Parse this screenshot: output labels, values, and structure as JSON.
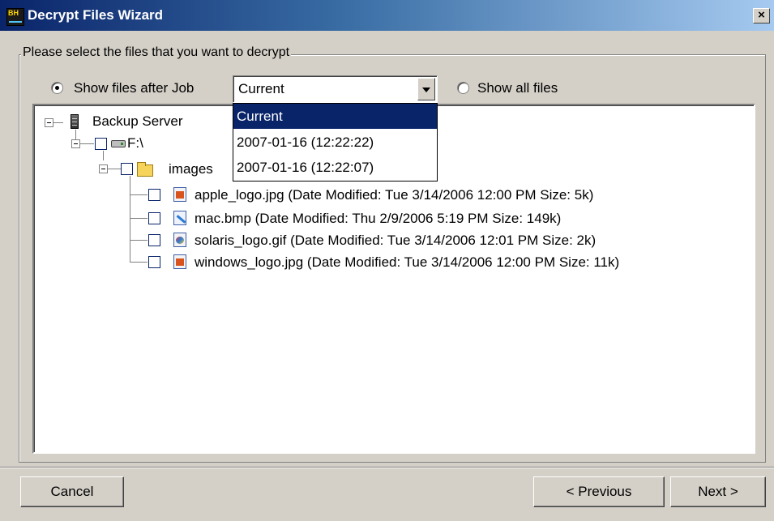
{
  "window": {
    "title": "Decrypt Files Wizard",
    "close_label": "×"
  },
  "group": {
    "legend": "Please select the files that you want to decrypt"
  },
  "options": {
    "show_after_job_label": "Show files after Job",
    "show_after_job_selected": true,
    "show_all_label": "Show all files",
    "show_all_selected": false,
    "job_select": {
      "value": "Current",
      "options": [
        "Current",
        "2007-01-16 (12:22:22)",
        "2007-01-16 (12:22:07)"
      ],
      "highlighted_index": 0
    }
  },
  "tree": {
    "root": {
      "label": "Backup Server",
      "icon": "server-icon"
    },
    "drive": {
      "label": "F:\\",
      "icon": "drive-icon"
    },
    "folder": {
      "label": "images",
      "icon": "folder-icon"
    },
    "files": [
      {
        "label": "apple_logo.jpg (Date Modified: Tue 3/14/2006 12:00 PM Size: 5k)",
        "icon": "jpg-icon"
      },
      {
        "label": "mac.bmp (Date Modified: Thu 2/9/2006 5:19 PM Size: 149k)",
        "icon": "bmp-icon"
      },
      {
        "label": "solaris_logo.gif (Date Modified: Tue 3/14/2006 12:01 PM Size: 2k)",
        "icon": "gif-icon"
      },
      {
        "label": "windows_logo.jpg (Date Modified: Tue 3/14/2006 12:00 PM Size: 11k)",
        "icon": "jpg-icon"
      }
    ]
  },
  "buttons": {
    "cancel": "Cancel",
    "previous": "< Previous",
    "next": "Next >"
  }
}
